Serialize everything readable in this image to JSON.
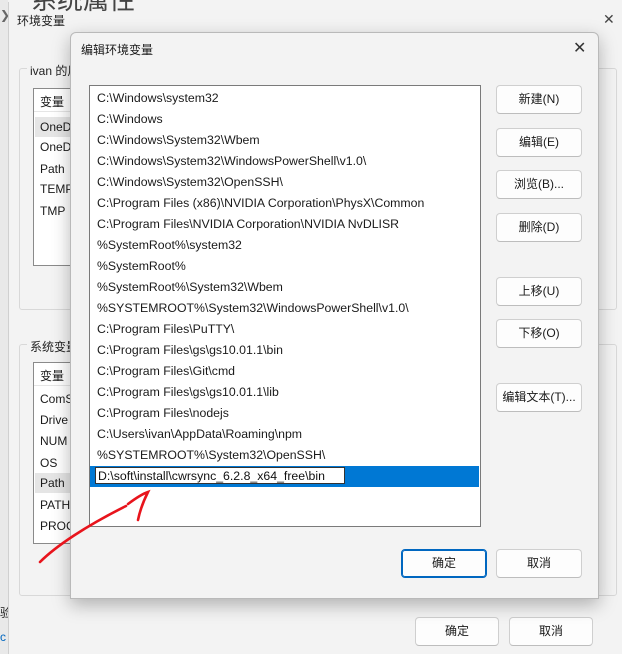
{
  "background_window": {
    "title": "环境变量",
    "big_title_partial": "系统属性",
    "user_group_title": "ivan 的用",
    "user_list": {
      "header": "变量",
      "rows": [
        "OneD",
        "OneD",
        "Path",
        "TEMP",
        "TMP"
      ]
    },
    "system_group_title": "系统变量",
    "system_list": {
      "header": "变量",
      "rows": [
        "ComS",
        "Drive",
        "NUM",
        "OS",
        "Path",
        "PATH",
        "PROC"
      ]
    },
    "ok_label": "确定",
    "cancel_label": "取消",
    "left_cut_text": "验",
    "left_cut_text2": "c"
  },
  "dialog": {
    "title": "编辑环境变量",
    "paths": [
      "C:\\Windows\\system32",
      "C:\\Windows",
      "C:\\Windows\\System32\\Wbem",
      "C:\\Windows\\System32\\WindowsPowerShell\\v1.0\\",
      "C:\\Windows\\System32\\OpenSSH\\",
      "C:\\Program Files (x86)\\NVIDIA Corporation\\PhysX\\Common",
      "C:\\Program Files\\NVIDIA Corporation\\NVIDIA NvDLISR",
      "%SystemRoot%\\system32",
      "%SystemRoot%",
      "%SystemRoot%\\System32\\Wbem",
      "%SYSTEMROOT%\\System32\\WindowsPowerShell\\v1.0\\",
      "C:\\Program Files\\PuTTY\\",
      "C:\\Program Files\\gs\\gs10.01.1\\bin",
      "C:\\Program Files\\Git\\cmd",
      "C:\\Program Files\\gs\\gs10.01.1\\lib",
      "C:\\Program Files\\nodejs",
      "C:\\Users\\ivan\\AppData\\Roaming\\npm",
      "%SYSTEMROOT%\\System32\\OpenSSH\\"
    ],
    "editing_value": "D:\\soft\\install\\cwrsync_6.2.8_x64_free\\bin",
    "buttons": {
      "new": "新建(N)",
      "edit": "编辑(E)",
      "browse": "浏览(B)...",
      "delete": "删除(D)",
      "move_up": "上移(U)",
      "move_down": "下移(O)",
      "edit_text": "编辑文本(T)..."
    },
    "ok_label": "确定",
    "cancel_label": "取消"
  },
  "colors": {
    "accent": "#0078d4",
    "annotation": "#e8141c"
  }
}
